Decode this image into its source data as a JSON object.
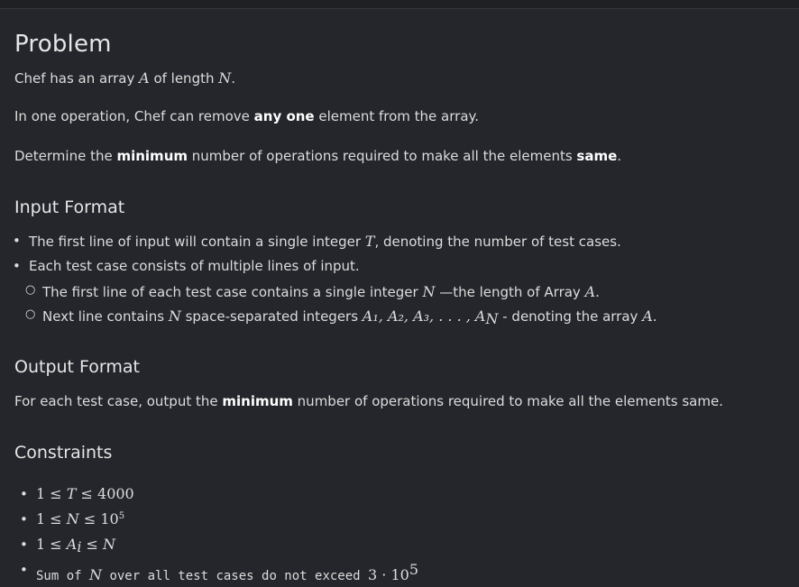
{
  "problem": {
    "heading": "Problem",
    "p1_a": "Chef has an array ",
    "p1_A": "A",
    "p1_b": " of length ",
    "p1_N": "N",
    "p1_c": ".",
    "p2_a": "In one operation, Chef can remove ",
    "p2_bold": "any one",
    "p2_b": " element from the array.",
    "p3_a": "Determine the ",
    "p3_bold1": "minimum",
    "p3_b": " number of operations required to make all the elements ",
    "p3_bold2": "same",
    "p3_c": "."
  },
  "input_format": {
    "heading": "Input Format",
    "li1_a": "The first line of input will contain a single integer ",
    "li1_T": "T",
    "li1_b": ", denoting the number of test cases.",
    "li2": "Each test case consists of multiple lines of input.",
    "sub1_a": "The first line of each test case contains a single integer ",
    "sub1_N": "N",
    "sub1_b": " —the length of Array ",
    "sub1_A": "A",
    "sub1_c": ".",
    "sub2_a": "Next line contains ",
    "sub2_N": "N",
    "sub2_b": " space-separated integers ",
    "sub2_seq": "A₁, A₂, A₃, . . . , A",
    "sub2_subN": "N",
    "sub2_c": " - denoting the array ",
    "sub2_A": "A",
    "sub2_d": "."
  },
  "output_format": {
    "heading": "Output Format",
    "p_a": "For each test case, output the ",
    "p_bold": "minimum",
    "p_b": " number of operations required to make all the elements same."
  },
  "constraints": {
    "heading": "Constraints",
    "c1_a": "1 ≤ ",
    "c1_var": "T",
    "c1_b": " ≤ 4000",
    "c2_a": "1 ≤ ",
    "c2_var": "N",
    "c2_b": " ≤ 10",
    "c2_exp": "5",
    "c3_a": "1 ≤ ",
    "c3_var": "A",
    "c3_sub": "i",
    "c3_b": " ≤ ",
    "c3_var2": "N",
    "c4_a": "Sum of ",
    "c4_var": "N",
    "c4_b": " over all test cases do not exceed ",
    "c4_c": "3 · 10",
    "c4_exp": "5"
  }
}
